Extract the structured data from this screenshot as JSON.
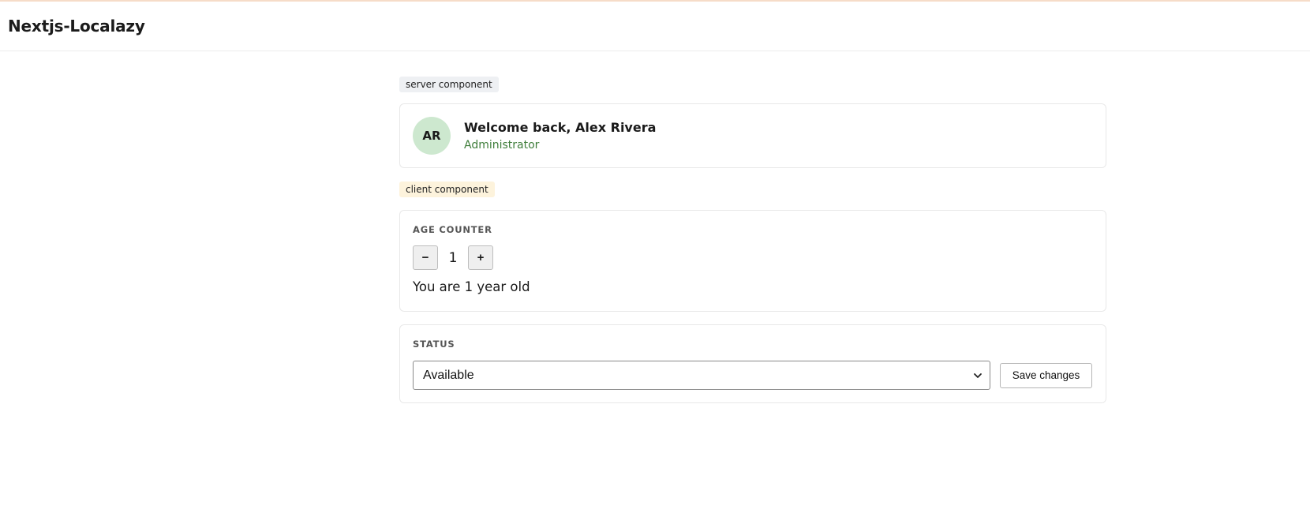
{
  "header": {
    "title": "Nextjs-Localazy"
  },
  "server_section": {
    "tag": "server component",
    "avatar_initials": "AR",
    "welcome": "Welcome back, Alex Rivera",
    "role": "Administrator"
  },
  "client_section": {
    "tag": "client component",
    "counter": {
      "label": "AGE COUNTER",
      "decrement_label": "−",
      "increment_label": "+",
      "value": "1",
      "sentence": "You are 1 year old"
    },
    "status": {
      "label": "STATUS",
      "selected": "Available",
      "save_label": "Save changes"
    }
  },
  "colors": {
    "avatar_bg": "#cde8cf",
    "role_text": "#3e7d3a",
    "server_tag_bg": "#eef0f3",
    "client_tag_bg": "#fdf3dc"
  },
  "icons": {
    "select_arrow": "chevron-down-icon"
  }
}
